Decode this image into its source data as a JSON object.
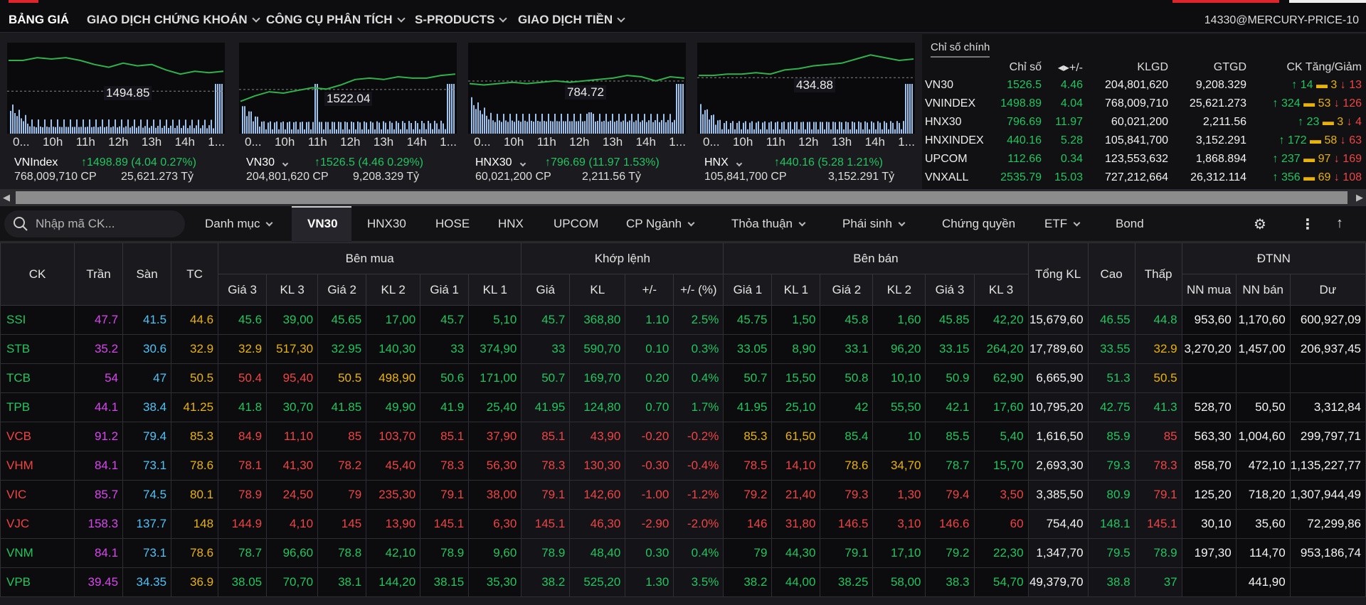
{
  "nav": {
    "items": [
      {
        "label": "BẢNG GIÁ",
        "dropdown": false,
        "active": true
      },
      {
        "label": "GIAO DỊCH CHỨNG KHOÁN",
        "dropdown": true,
        "active": false
      },
      {
        "label": "CÔNG CỤ PHÂN TÍCH",
        "dropdown": true,
        "active": false
      },
      {
        "label": "S-PRODUCTS",
        "dropdown": true,
        "active": false
      },
      {
        "label": "GIAO DỊCH TIỀN",
        "dropdown": true,
        "active": false
      }
    ],
    "account": "14330@MERCURY-PRICE-10"
  },
  "mini_charts": [
    {
      "name": "VNIndex",
      "current_label": "1494.85",
      "change": "↑1498.89 (4.04  0.27%)",
      "volume": "768,009,710 CP",
      "value": "25,621.273 Tỷ",
      "times": [
        "0...",
        "10h",
        "11h",
        "12h",
        "13h",
        "14h",
        "1..."
      ]
    },
    {
      "name": "VN30",
      "current_label": "1522.04",
      "change": "↑1526.5 (4.46  0.29%)",
      "volume": "204,801,620 CP",
      "value": "9,208.329 Tỷ",
      "times": [
        "0...",
        "10h",
        "11h",
        "12h",
        "13h",
        "14h",
        "1..."
      ]
    },
    {
      "name": "HNX30",
      "current_label": "784.72",
      "change": "↑796.69 (11.97  1.53%)",
      "volume": "60,021,200 CP",
      "value": "2,211.56 Tỷ",
      "times": [
        "0...",
        "10h",
        "11h",
        "12h",
        "13h",
        "14h",
        "1..."
      ]
    },
    {
      "name": "HNX",
      "current_label": "434.88",
      "change": "↑440.16 (5.28  1.21%)",
      "volume": "105,841,700 CP",
      "value": "3,152.291 Tỷ",
      "times": [
        "0...",
        "10h",
        "11h",
        "12h",
        "13h",
        "14h",
        "1..."
      ]
    }
  ],
  "index_panel": {
    "tab": "Chỉ số chính",
    "headers": [
      "",
      "Chỉ số",
      "+/-",
      "KLGD",
      "GTGD",
      "CK Tăng/Giảm"
    ],
    "rows": [
      {
        "name": "VN30",
        "value": "1526.5",
        "change": "4.46",
        "volume": "204,801,620",
        "turnover": "9,208.329",
        "up": "14",
        "flat": "3",
        "down": "13"
      },
      {
        "name": "VNINDEX",
        "value": "1498.89",
        "change": "4.04",
        "volume": "768,009,710",
        "turnover": "25,621.273",
        "up": "324",
        "flat": "53",
        "down": "126"
      },
      {
        "name": "HNX30",
        "value": "796.69",
        "change": "11.97",
        "volume": "60,021,200",
        "turnover": "2,211.56",
        "up": "23",
        "flat": "3",
        "down": "4"
      },
      {
        "name": "HNXINDEX",
        "value": "440.16",
        "change": "5.28",
        "volume": "105,841,700",
        "turnover": "3,152.291",
        "up": "172",
        "flat": "58",
        "down": "63"
      },
      {
        "name": "UPCOM",
        "value": "112.66",
        "change": "0.34",
        "volume": "123,553,632",
        "turnover": "1,868.894",
        "up": "237",
        "flat": "97",
        "down": "169"
      },
      {
        "name": "VNXALL",
        "value": "2535.79",
        "change": "15.03",
        "volume": "727,212,664",
        "turnover": "26,312.114",
        "up": "356",
        "flat": "69",
        "down": "108"
      }
    ]
  },
  "filter": {
    "search_placeholder": "Nhập mã CK...",
    "tabs": [
      {
        "label": "Danh mục",
        "dropdown": true
      },
      {
        "label": "VN30",
        "dropdown": false,
        "active": true
      },
      {
        "label": "HNX30",
        "dropdown": false
      },
      {
        "label": "HOSE",
        "dropdown": false
      },
      {
        "label": "HNX",
        "dropdown": false
      },
      {
        "label": "UPCOM",
        "dropdown": false
      },
      {
        "label": "CP Ngành",
        "dropdown": true
      },
      {
        "label": "Thỏa thuận",
        "dropdown": true
      },
      {
        "label": "Phái sinh",
        "dropdown": true
      },
      {
        "label": "Chứng quyền",
        "dropdown": false
      },
      {
        "label": "ETF",
        "dropdown": true
      },
      {
        "label": "Bond",
        "dropdown": false
      }
    ]
  },
  "board": {
    "group_headers": {
      "buy": "Bên mua",
      "match": "Khớp lệnh",
      "sell": "Bên bán",
      "foreign": "ĐTNN"
    },
    "single_headers": {
      "symbol": "CK",
      "ceiling": "Trần",
      "floor": "Sàn",
      "ref": "TC",
      "total": "Tổng KL",
      "high": "Cao",
      "low": "Thấp"
    },
    "sub_headers": {
      "buy": [
        "Giá 3",
        "KL 3",
        "Giá 2",
        "KL 2",
        "Giá 1",
        "KL 1"
      ],
      "match": [
        "Giá",
        "KL",
        "+/-",
        "+/- (%)"
      ],
      "sell": [
        "Giá 1",
        "KL 1",
        "Giá 2",
        "KL 2",
        "Giá 3",
        "KL 3"
      ],
      "foreign": [
        "NN mua",
        "NN bán",
        "Dư"
      ]
    },
    "rows": [
      {
        "sym": "SSI",
        "c": "47.7",
        "f": "41.5",
        "r": "44.6",
        "b": [
          [
            "45.6",
            "39,00"
          ],
          [
            "45.65",
            "17,00"
          ],
          [
            "45.7",
            "5,10"
          ]
        ],
        "m": [
          "45.7",
          "368,80",
          "1.10",
          "2.5%"
        ],
        "s": [
          [
            "45.75",
            "1,50"
          ],
          [
            "45.8",
            "1,60"
          ],
          [
            "45.85",
            "42,20"
          ]
        ],
        "tk": "15,679,60",
        "hi": "46.55",
        "lo": "44.8",
        "nn": [
          "953,60",
          "1,170,60",
          "600,927,09"
        ],
        "col": {
          "sym": "g",
          "b": [
            "g",
            "g",
            "g"
          ],
          "m": "g",
          "s": [
            "g",
            "g",
            "g"
          ],
          "hi": "g",
          "lo": "g"
        }
      },
      {
        "sym": "STB",
        "c": "35.2",
        "f": "30.6",
        "r": "32.9",
        "b": [
          [
            "32.9",
            "517,30"
          ],
          [
            "32.95",
            "140,30"
          ],
          [
            "33",
            "374,90"
          ]
        ],
        "m": [
          "33",
          "590,70",
          "0.10",
          "0.3%"
        ],
        "s": [
          [
            "33.05",
            "8,90"
          ],
          [
            "33.1",
            "96,20"
          ],
          [
            "33.15",
            "264,20"
          ]
        ],
        "tk": "17,789,60",
        "hi": "33.55",
        "lo": "32.9",
        "nn": [
          "3,270,20",
          "1,457,00",
          "206,937,45"
        ],
        "col": {
          "sym": "g",
          "b": [
            "y",
            "g",
            "g"
          ],
          "m": "g",
          "s": [
            "g",
            "g",
            "g"
          ],
          "hi": "g",
          "lo": "y"
        }
      },
      {
        "sym": "TCB",
        "c": "54",
        "f": "47",
        "r": "50.5",
        "b": [
          [
            "50.4",
            "95,40"
          ],
          [
            "50.5",
            "498,90"
          ],
          [
            "50.6",
            "171,00"
          ]
        ],
        "m": [
          "50.7",
          "169,70",
          "0.20",
          "0.4%"
        ],
        "s": [
          [
            "50.7",
            "15,50"
          ],
          [
            "50.8",
            "10,10"
          ],
          [
            "50.9",
            "62,90"
          ]
        ],
        "tk": "6,665,90",
        "hi": "51.3",
        "lo": "50.5",
        "nn": [
          "",
          "",
          ""
        ],
        "col": {
          "sym": "g",
          "b": [
            "r",
            "y",
            "g"
          ],
          "m": "g",
          "s": [
            "g",
            "g",
            "g"
          ],
          "hi": "g",
          "lo": "y"
        }
      },
      {
        "sym": "TPB",
        "c": "44.1",
        "f": "38.4",
        "r": "41.25",
        "b": [
          [
            "41.8",
            "30,70"
          ],
          [
            "41.85",
            "49,90"
          ],
          [
            "41.9",
            "25,40"
          ]
        ],
        "m": [
          "41.95",
          "124,80",
          "0.70",
          "1.7%"
        ],
        "s": [
          [
            "41.95",
            "25,10"
          ],
          [
            "42",
            "55,50"
          ],
          [
            "42.1",
            "17,60"
          ]
        ],
        "tk": "10,795,20",
        "hi": "42.75",
        "lo": "41.3",
        "nn": [
          "528,70",
          "50,50",
          "3,312,84"
        ],
        "col": {
          "sym": "g",
          "b": [
            "g",
            "g",
            "g"
          ],
          "m": "g",
          "s": [
            "g",
            "g",
            "g"
          ],
          "hi": "g",
          "lo": "g"
        }
      },
      {
        "sym": "VCB",
        "c": "91.2",
        "f": "79.4",
        "r": "85.3",
        "b": [
          [
            "84.9",
            "11,10"
          ],
          [
            "85",
            "103,70"
          ],
          [
            "85.1",
            "37,90"
          ]
        ],
        "m": [
          "85.1",
          "43,90",
          "-0.20",
          "-0.2%"
        ],
        "s": [
          [
            "85.3",
            "61,50"
          ],
          [
            "85.4",
            "10"
          ],
          [
            "85.5",
            "5,40"
          ]
        ],
        "tk": "1,616,50",
        "hi": "85.9",
        "lo": "85",
        "nn": [
          "563,30",
          "1,004,60",
          "299,797,71"
        ],
        "col": {
          "sym": "r",
          "b": [
            "r",
            "r",
            "r"
          ],
          "m": "r",
          "s": [
            "y",
            "g",
            "g"
          ],
          "hi": "g",
          "lo": "r"
        }
      },
      {
        "sym": "VHM",
        "c": "84.1",
        "f": "73.1",
        "r": "78.6",
        "b": [
          [
            "78.1",
            "41,30"
          ],
          [
            "78.2",
            "45,40"
          ],
          [
            "78.3",
            "56,30"
          ]
        ],
        "m": [
          "78.3",
          "130,30",
          "-0.30",
          "-0.4%"
        ],
        "s": [
          [
            "78.5",
            "14,10"
          ],
          [
            "78.6",
            "34,70"
          ],
          [
            "78.7",
            "15,70"
          ]
        ],
        "tk": "2,693,30",
        "hi": "79.3",
        "lo": "78.3",
        "nn": [
          "858,70",
          "472,10",
          "1,135,227,77"
        ],
        "col": {
          "sym": "r",
          "b": [
            "r",
            "r",
            "r"
          ],
          "m": "r",
          "s": [
            "r",
            "y",
            "g"
          ],
          "hi": "g",
          "lo": "r"
        }
      },
      {
        "sym": "VIC",
        "c": "85.7",
        "f": "74.5",
        "r": "80.1",
        "b": [
          [
            "78.9",
            "24,50"
          ],
          [
            "79",
            "235,30"
          ],
          [
            "79.1",
            "38,00"
          ]
        ],
        "m": [
          "79.1",
          "142,60",
          "-1.00",
          "-1.2%"
        ],
        "s": [
          [
            "79.2",
            "21,40"
          ],
          [
            "79.3",
            "1,30"
          ],
          [
            "79.4",
            "3,50"
          ]
        ],
        "tk": "3,385,50",
        "hi": "80.9",
        "lo": "79.1",
        "nn": [
          "125,20",
          "718,20",
          "1,307,944,49"
        ],
        "col": {
          "sym": "r",
          "b": [
            "r",
            "r",
            "r"
          ],
          "m": "r",
          "s": [
            "r",
            "r",
            "r"
          ],
          "hi": "g",
          "lo": "r"
        }
      },
      {
        "sym": "VJC",
        "c": "158.3",
        "f": "137.7",
        "r": "148",
        "b": [
          [
            "144.9",
            "4,10"
          ],
          [
            "145",
            "13,90"
          ],
          [
            "145.1",
            "6,30"
          ]
        ],
        "m": [
          "145.1",
          "46,30",
          "-2.90",
          "-2.0%"
        ],
        "s": [
          [
            "146",
            "31,80"
          ],
          [
            "146.5",
            "3,10"
          ],
          [
            "146.6",
            "60"
          ]
        ],
        "tk": "754,40",
        "hi": "148.1",
        "lo": "145.1",
        "nn": [
          "30,10",
          "35,60",
          "72,299,86"
        ],
        "col": {
          "sym": "r",
          "b": [
            "r",
            "r",
            "r"
          ],
          "m": "r",
          "s": [
            "r",
            "r",
            "r"
          ],
          "hi": "g",
          "lo": "r"
        }
      },
      {
        "sym": "VNM",
        "c": "84.1",
        "f": "73.1",
        "r": "78.6",
        "b": [
          [
            "78.7",
            "96,60"
          ],
          [
            "78.8",
            "42,10"
          ],
          [
            "78.9",
            "9,60"
          ]
        ],
        "m": [
          "78.9",
          "48,40",
          "0.30",
          "0.4%"
        ],
        "s": [
          [
            "79",
            "44,30"
          ],
          [
            "79.1",
            "17,10"
          ],
          [
            "79.2",
            "22,30"
          ]
        ],
        "tk": "1,347,70",
        "hi": "79.5",
        "lo": "78.9",
        "nn": [
          "197,30",
          "114,70",
          "953,186,74"
        ],
        "col": {
          "sym": "g",
          "b": [
            "g",
            "g",
            "g"
          ],
          "m": "g",
          "s": [
            "g",
            "g",
            "g"
          ],
          "hi": "g",
          "lo": "g"
        }
      },
      {
        "sym": "VPB",
        "c": "39.45",
        "f": "34.35",
        "r": "36.9",
        "b": [
          [
            "38.05",
            "70,70"
          ],
          [
            "38.1",
            "144,20"
          ],
          [
            "38.15",
            "35,30"
          ]
        ],
        "m": [
          "38.2",
          "525,20",
          "1.30",
          "3.5%"
        ],
        "s": [
          [
            "38.2",
            "44,00"
          ],
          [
            "38.25",
            "58,00"
          ],
          [
            "38.3",
            "54,70"
          ]
        ],
        "tk": "49,379,70",
        "hi": "38.8",
        "lo": "37",
        "nn": [
          "",
          "441,90",
          ""
        ],
        "col": {
          "sym": "g",
          "b": [
            "g",
            "g",
            "g"
          ],
          "m": "g",
          "s": [
            "g",
            "g",
            "g"
          ],
          "hi": "g",
          "lo": "g"
        }
      }
    ]
  },
  "colors": {
    "up": "#22c55e",
    "down": "#ef4444",
    "ref": "#eab308",
    "ceiling": "#d946ef",
    "floor": "#4fc3f7",
    "chart_line": "#2fb24c",
    "chart_volume": "#9cc3ee"
  }
}
